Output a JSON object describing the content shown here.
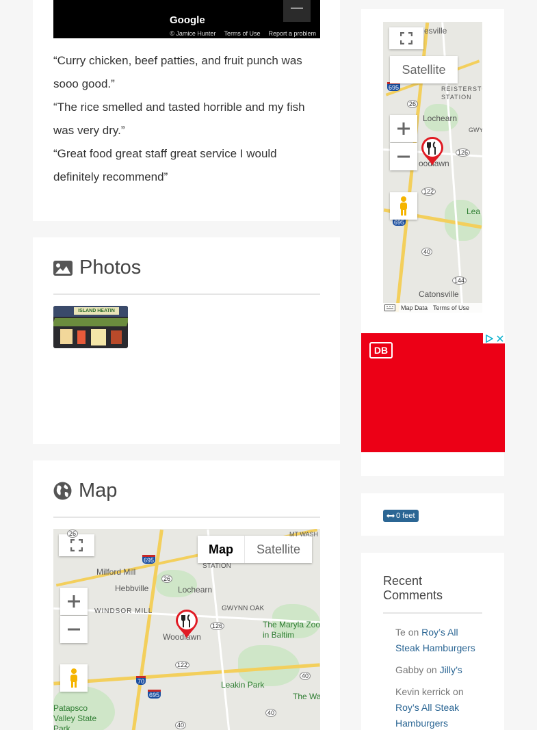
{
  "top_map": {
    "google_logo": "Google",
    "attribution": "© Jamice Hunter",
    "terms": "Terms of Use",
    "report": "Report a problem"
  },
  "reviews": [
    "“Curry chicken, beef patties, and fruit punch was sooo good.”",
    "“The rice smelled and tasted horrible and my fish was very dry.”",
    "“Great food great staff great service I would definitely recommend”"
  ],
  "photos": {
    "title": "Photos",
    "thumb_sign": "ISLAND HEATIN"
  },
  "map_section": {
    "title": "Map",
    "map_button": "Map",
    "satellite_button": "Satellite",
    "labels": {
      "milford_mill": "Milford Mill",
      "hebbville": "Hebbville",
      "windsor_mill": "WINDSOR MILL",
      "lochearn": "Lochearn",
      "gwynn_oak": "GWYNN OAK",
      "woodlawn": "Woodlawn",
      "maryland_zoo": "The Marylа Zoo in Baltim",
      "leakin_park": "Leakin Park",
      "patapsco": "Patapsco Valley State Park",
      "station": "STATION",
      "mt_wash": "MT WASH",
      "the_w": "The Wa"
    },
    "shields": [
      "26",
      "695",
      "26",
      "126",
      "122",
      "70",
      "695",
      "40",
      "40",
      "40"
    ]
  },
  "side_map": {
    "satellite_button": "Satellite",
    "labels": {
      "esville": "esville",
      "reisterstown": "REISTERSTO STATION",
      "lochearn": "Lochearn",
      "gwy": "GWY",
      "woodlawn": "oodlawn",
      "lea": "Lea",
      "catonsville": "Catonsville"
    },
    "shields": [
      "695",
      "26",
      "126",
      "122",
      "695",
      "40",
      "144"
    ],
    "map_data": "Map Data",
    "terms": "Terms of Use"
  },
  "ad": {
    "brand": "DB",
    "color": "#ec0016"
  },
  "distance_badge": "0 feet",
  "recent_comments": {
    "title": "Recent Comments",
    "items": [
      {
        "author": "Te",
        "on": "on",
        "post": "Roy’s All Steak Hamburgers"
      },
      {
        "author": "Gabby",
        "on": "on",
        "post": "Jilly’s"
      },
      {
        "author": "Kevin kerrick",
        "on": "on",
        "post": "Roy’s All Steak Hamburgers"
      }
    ]
  }
}
